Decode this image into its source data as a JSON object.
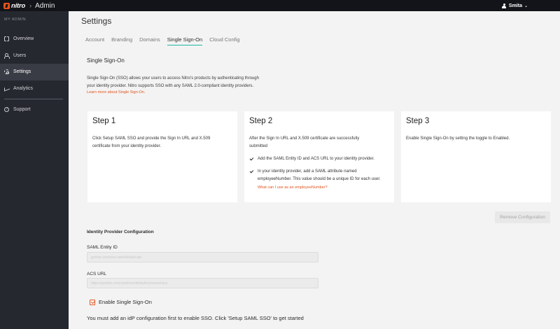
{
  "topbar": {
    "brand": "nitro",
    "separator": "›",
    "app_name": "Admin",
    "user_name": "Smita",
    "user_chevron": "⌄"
  },
  "sidebar": {
    "heading": "MY ADMIN",
    "items": [
      {
        "label": "Overview",
        "icon": "overview-icon"
      },
      {
        "label": "Users",
        "icon": "users-icon"
      },
      {
        "label": "Settings",
        "icon": "settings-icon",
        "active": true
      },
      {
        "label": "Analytics",
        "icon": "analytics-icon"
      }
    ],
    "support_label": "Support"
  },
  "page": {
    "title": "Settings",
    "tabs": [
      "Account",
      "Branding",
      "Domains",
      "Single Sign-On",
      "Cloud Config"
    ],
    "active_tab": "Single Sign-On"
  },
  "sso": {
    "section_title": "Single Sign-On",
    "description_line1": "Single Sign-On (SSO) allows your users to access Nitro's products by authenticating through",
    "description_line2": "your identity provider. Nitro supports SSO with any SAML 2.0-compliant identity providers.",
    "learn_more": "Learn more about Single Sign-On.",
    "steps": [
      {
        "title": "Step 1",
        "text_line1": "Click Setup SAML SSO and provide the Sign In URL and X.509",
        "text_line2": "certificate from your identity provider."
      },
      {
        "title": "Step 2",
        "text_line1": "After the Sign In URL and X.509 certificate are successfully",
        "text_line2": "submitted",
        "check1": "Add the SAML Entity ID and ACS URL to your identity provider.",
        "check2_line1": "In your identity provider, add a SAML attribute named",
        "check2_line2": "employeeNumber. This value should be a unique ID for each user.",
        "link": "What can I use as an employeeNumber?"
      },
      {
        "title": "Step 3",
        "text_line1": "Enable Single Sign-On by setting the toggle to Enabled."
      }
    ],
    "remove_button": "Remove Configuration",
    "idp_title": "Identity Provider Configuration",
    "entity_id_label": "SAML Entity ID",
    "entity_id_value": "gonitro.com/sso-saml/default.idp",
    "acs_label": "ACS URL",
    "acs_value": "https://gonitro.com/saml/sso/default/consume/acs",
    "enable_label": "Enable Single Sign-On",
    "enable_checked": true,
    "note": "You must add an idP configuration first to enable SSO. Click 'Setup SAML SSO' to get started"
  },
  "colors": {
    "accent_orange": "#e0541f",
    "tab_underline": "#1fb6a6",
    "sidebar_bg": "#262830",
    "topbar_bg": "#131419"
  }
}
